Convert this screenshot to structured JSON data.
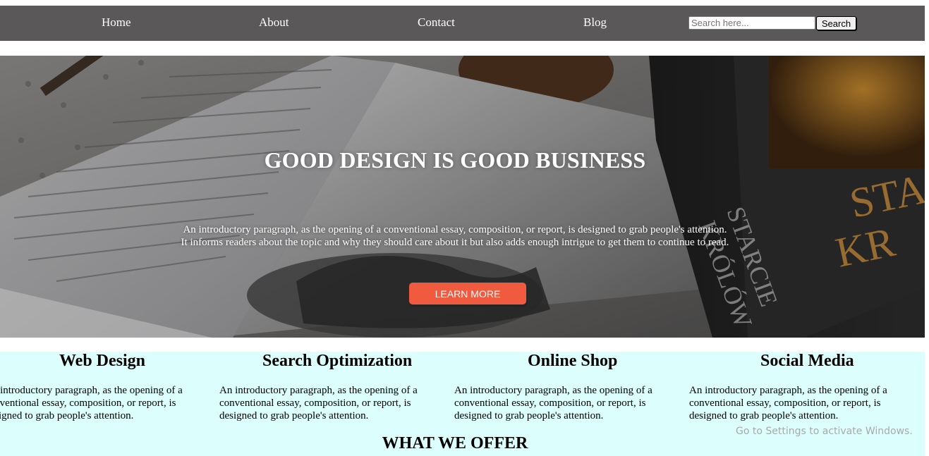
{
  "nav": {
    "links": [
      {
        "label": "Home"
      },
      {
        "label": "About"
      },
      {
        "label": "Contact"
      },
      {
        "label": "Blog"
      }
    ],
    "search": {
      "placeholder": "Search here...",
      "value": "",
      "button_label": "Search"
    }
  },
  "hero": {
    "title": "GOOD DESIGN IS GOOD BUSINESS",
    "text_line1": "An introductory paragraph, as the opening of a conventional essay, composition, or report, is designed to grab people's attention.",
    "text_line2": "It informs readers about the topic and why they should care about it but also adds enough intrigue to get them to continue to read.",
    "button_label": "LEARN MORE"
  },
  "services": [
    {
      "title": "Web Design",
      "text": "An introductory paragraph, as the opening of a conventional essay, composition, or report, is designed to grab people's attention."
    },
    {
      "title": "Search Optimization",
      "text": "An introductory paragraph, as the opening of a conventional essay, composition, or report, is designed to grab people's attention."
    },
    {
      "title": "Online Shop",
      "text": "An introductory paragraph, as the opening of a conventional essay, composition, or report, is designed to grab people's attention."
    },
    {
      "title": "Social Media",
      "text": "An introductory paragraph, as the opening of a conventional essay, composition, or report, is designed to grab people's attention."
    }
  ],
  "offer_title": "WHAT WE OFFER",
  "watermark": "Go to Settings to activate Windows.",
  "colors": {
    "navbar": "#5a5858",
    "button_accent": "#f05a3f",
    "services_bg": "#dcfffe"
  }
}
